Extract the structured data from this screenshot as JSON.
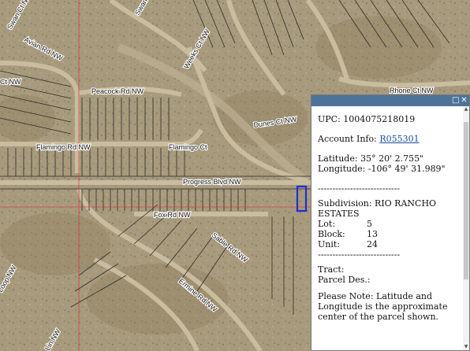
{
  "map": {
    "roads": [
      {
        "label": "Progress Blvd NW"
      },
      {
        "label": "Peacock Rd NW"
      },
      {
        "label": "Flamingo Rd NW"
      },
      {
        "label": "Flamingo Ct"
      },
      {
        "label": "Fox Rd NW"
      },
      {
        "label": "Sable Rd NW"
      },
      {
        "label": "Ermine Rd NW"
      },
      {
        "label": "Avian Rd NW"
      },
      {
        "label": "Swan Ct NW"
      },
      {
        "label": "Weeks Ct NW"
      },
      {
        "label": "Rhone Ct NW"
      },
      {
        "label": "Swan Ct NW"
      },
      {
        "label": "Dunes Ct NW"
      },
      {
        "label": "Ct NW"
      },
      {
        "label": "Loop NW"
      },
      {
        "label": "Lin NW"
      }
    ],
    "colors": {
      "terrain": "#a89a7c",
      "parcel_line": "#2b2b2b",
      "highlight": "#1f2fd6",
      "section_line": "#e0303a"
    }
  },
  "popup": {
    "upc_label": "UPC:",
    "upc_value": "1004075218019",
    "account_label": "Account Info:",
    "account_value": "R055301",
    "latitude_label": "Latitude:",
    "latitude_value": "35° 20' 2.755\"",
    "longitude_label": "Longitude:",
    "longitude_value": "-106° 49' 31.989\"",
    "divider": "----------------------------",
    "subdivision_label": "Subdivision:",
    "subdivision_value": "RIO RANCHO ESTATES",
    "lot_label": "Lot:",
    "lot_value": "5",
    "block_label": "Block:",
    "block_value": "13",
    "unit_label": "Unit:",
    "unit_value": "24",
    "divider2": "----------------------------",
    "tract_label": "Tract:",
    "parcel_label": "Parcel Des.:",
    "note": "Please Note: Latitude and Longitude is the approximate center of the parcel shown.",
    "maximize_icon": "maximize-icon",
    "close_icon": "close-icon"
  }
}
